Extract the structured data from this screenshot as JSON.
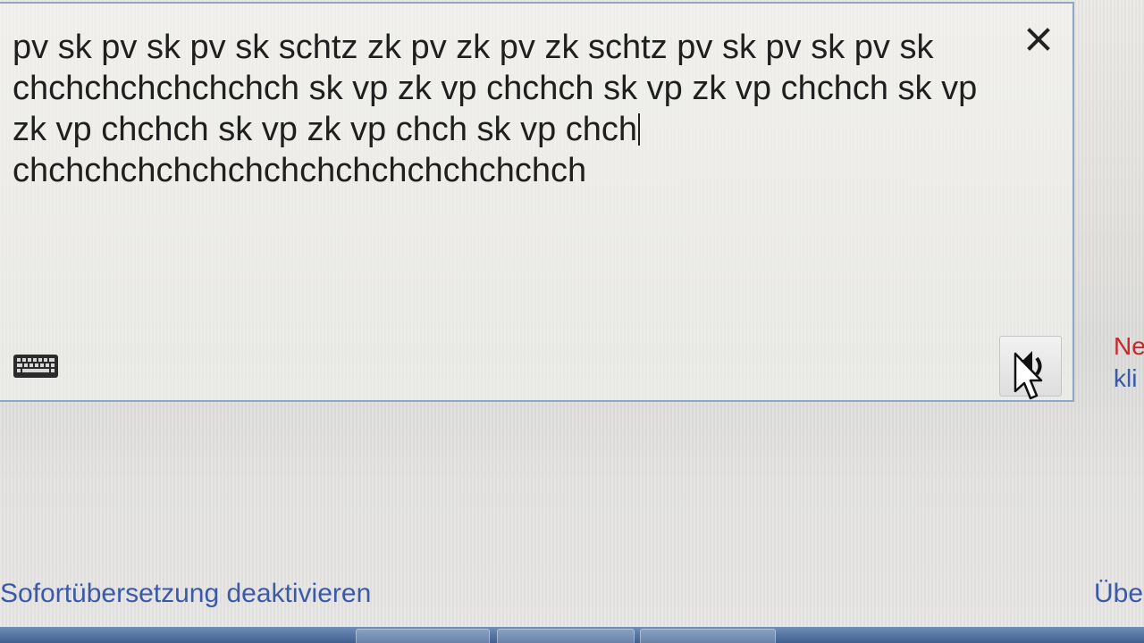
{
  "source": {
    "text_before_caret": "pv sk pv sk pv sk schtz zk pv zk pv zk schtz pv sk pv sk pv sk chchchchchchchch sk vp zk vp chchch sk vp zk vp chchch sk vp zk vp chchch sk vp zk vp chch sk vp chch",
    "text_after_caret": "chchchchchchchchchchchchchchchch"
  },
  "icons": {
    "close": "close-icon",
    "keyboard": "keyboard-icon",
    "speaker": "speaker-icon",
    "cursor": "mouse-pointer-icon"
  },
  "side_hint": {
    "red_fragment": "Ne",
    "blue_fragment": "kli"
  },
  "links": {
    "instant_translation": "Sofortübersetzung deaktivieren",
    "right_fragment": "Übe"
  },
  "colors": {
    "link": "#3a5aa8",
    "hint_red": "#c8282a",
    "box_border": "#8fa6c8"
  }
}
